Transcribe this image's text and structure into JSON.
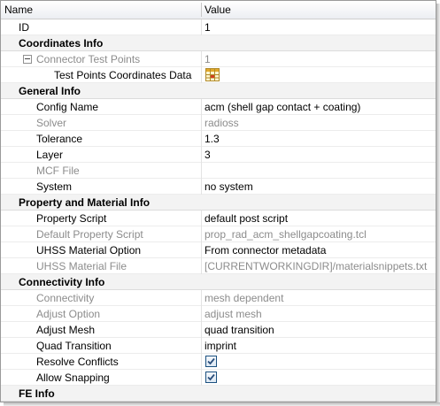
{
  "header": {
    "name": "Name",
    "value": "Value"
  },
  "rows": {
    "id": {
      "name": "ID",
      "value": "1"
    },
    "coords_section": {
      "name": "Coordinates Info"
    },
    "connector_test_points": {
      "name": "Connector Test Points",
      "value": "1"
    },
    "test_points_coords": {
      "name": "Test Points Coordinates Data",
      "icon": "table-grid-icon"
    },
    "general_section": {
      "name": "General Info"
    },
    "config_name": {
      "name": "Config Name",
      "value": "acm (shell gap contact + coating)"
    },
    "solver": {
      "name": "Solver",
      "value": "radioss"
    },
    "tolerance": {
      "name": "Tolerance",
      "value": "1.3"
    },
    "layer": {
      "name": "Layer",
      "value": "3"
    },
    "mcf_file": {
      "name": "MCF File",
      "value": ""
    },
    "system": {
      "name": "System",
      "value": "no system"
    },
    "prop_section": {
      "name": "Property and Material Info"
    },
    "property_script": {
      "name": "Property Script",
      "value": "default post script"
    },
    "default_property_script": {
      "name": "Default Property Script",
      "value": "prop_rad_acm_shellgapcoating.tcl"
    },
    "uhss_material_option": {
      "name": "UHSS Material Option",
      "value": "From connector metadata"
    },
    "uhss_material_file": {
      "name": "UHSS Material File",
      "value": "[CURRENTWORKINGDIR]/materialsnippets.txt"
    },
    "connectivity_section": {
      "name": "Connectivity Info"
    },
    "connectivity": {
      "name": "Connectivity",
      "value": "mesh dependent"
    },
    "adjust_option": {
      "name": "Adjust Option",
      "value": "adjust mesh"
    },
    "adjust_mesh": {
      "name": "Adjust Mesh",
      "value": "quad transition"
    },
    "quad_transition": {
      "name": "Quad Transition",
      "value": "imprint"
    },
    "resolve_conflicts": {
      "name": "Resolve Conflicts",
      "checked": true
    },
    "allow_snapping": {
      "name": "Allow Snapping",
      "checked": true
    },
    "fe_section": {
      "name": "FE Info"
    }
  },
  "colors": {
    "disabled_text": "#8c8c8c",
    "section_bg": "#f3f3f3",
    "check_border": "#1c5180",
    "check_mark": "#2b4f7c"
  }
}
